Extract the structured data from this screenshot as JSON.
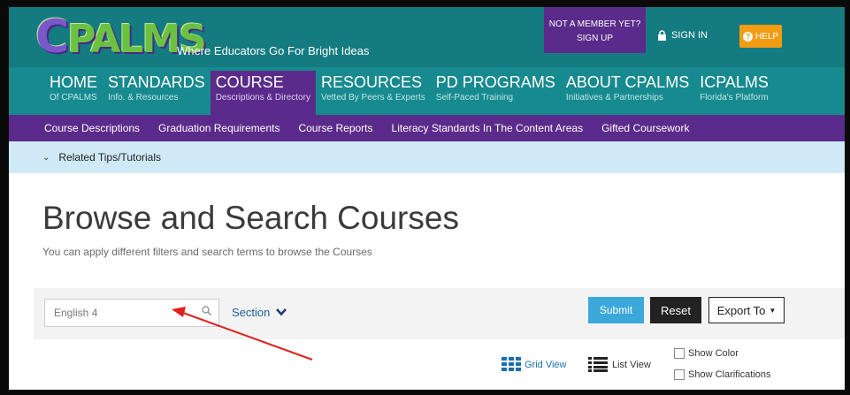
{
  "header": {
    "logo_text": "CPALMS",
    "tagline": "Where Educators Go For Bright Ideas",
    "member_line1": "NOT A MEMBER YET?",
    "member_line2": "SIGN UP",
    "sign_in": "SIGN IN",
    "help": "HELP"
  },
  "nav": [
    {
      "title": "HOME",
      "sub": "Of CPALMS"
    },
    {
      "title": "STANDARDS",
      "sub": "Info. & Resources"
    },
    {
      "title": "COURSE",
      "sub": "Descriptions & Directory"
    },
    {
      "title": "RESOURCES",
      "sub": "Vetted By Peers & Experts"
    },
    {
      "title": "PD PROGRAMS",
      "sub": "Self-Paced Training"
    },
    {
      "title": "ABOUT CPALMS",
      "sub": "Initiatives & Partnerships"
    },
    {
      "title": "ICPALMS",
      "sub": "Florida's Platform"
    }
  ],
  "subnav": [
    "Course Descriptions",
    "Graduation Requirements",
    "Course Reports",
    "Literacy Standards In The Content Areas",
    "Gifted Coursework"
  ],
  "tips": {
    "label": "Related Tips/Tutorials"
  },
  "main": {
    "title": "Browse and Search Courses",
    "subtitle": "You can apply different filters and search terms to browse the Courses"
  },
  "toolbar": {
    "search_value": "English 4",
    "section_label": "Section",
    "submit": "Submit",
    "reset": "Reset",
    "export": "Export To"
  },
  "view": {
    "grid": "Grid View",
    "list": "List View",
    "show_color": "Show Color",
    "show_clarifications": "Show Clarifications"
  },
  "colors": {
    "teal": "#178a8f",
    "purple": "#5a2b8a",
    "tips_bg": "#cfe9f6",
    "submit": "#3aa9d9",
    "help": "#f39c12",
    "annotation_arrow": "#e0201b"
  },
  "icons": [
    "lock-icon",
    "help-icon",
    "chevron-down-icon",
    "search-icon",
    "grid-view-icon",
    "list-view-icon",
    "caret-down-icon"
  ]
}
